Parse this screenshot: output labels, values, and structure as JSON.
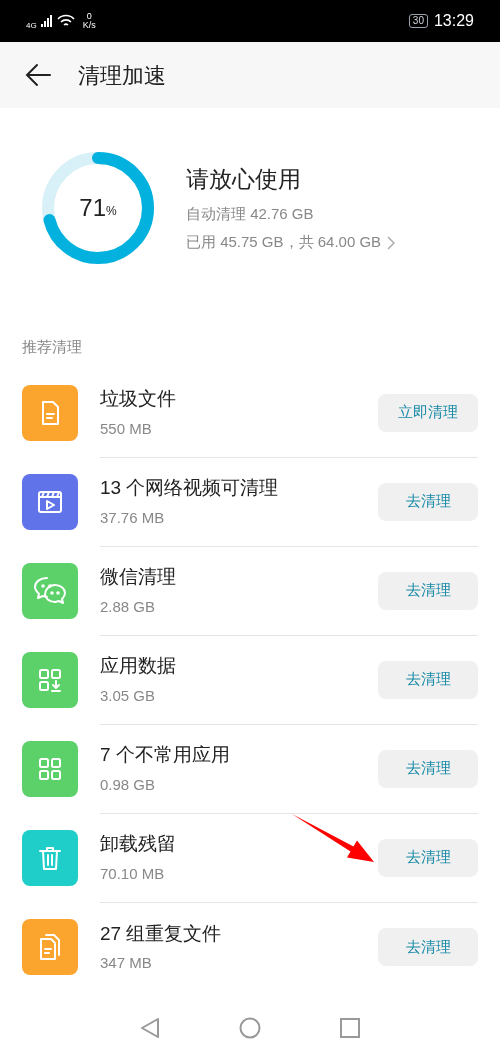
{
  "status_bar": {
    "network": "4G",
    "speed_value": "0",
    "speed_unit": "K/s",
    "battery": "30",
    "time": "13:29"
  },
  "header": {
    "title": "清理加速"
  },
  "storage": {
    "level": 0.71,
    "percent": "71",
    "percent_sign": "%",
    "status": "请放心使用",
    "auto_clean": "自动清理 42.76 GB",
    "usage": "已用 45.75 GB，共 64.00 GB"
  },
  "section_label": "推荐清理",
  "items": [
    {
      "kind": "file",
      "color": "#fba52e",
      "title": "垃圾文件",
      "size": "550 MB",
      "action": "立即清理"
    },
    {
      "kind": "video",
      "color": "#6173e8",
      "title": "13 个网络视频可清理",
      "size": "37.76 MB",
      "action": "去清理"
    },
    {
      "kind": "chat",
      "color": "#5cd16a",
      "title": "微信清理",
      "size": "2.88 GB",
      "action": "去清理"
    },
    {
      "kind": "appdata",
      "color": "#5cd16a",
      "title": "应用数据",
      "size": "3.05 GB",
      "action": "去清理"
    },
    {
      "kind": "apps",
      "color": "#5cd16a",
      "title": "7 个不常用应用",
      "size": "0.98 GB",
      "action": "去清理"
    },
    {
      "kind": "trash",
      "color": "#1fcdc9",
      "title": "卸载残留",
      "size": "70.10 MB",
      "action": "去清理"
    },
    {
      "kind": "files",
      "color": "#fba52e",
      "title": "27 组重复文件",
      "size": "347 MB",
      "action": "去清理"
    }
  ]
}
